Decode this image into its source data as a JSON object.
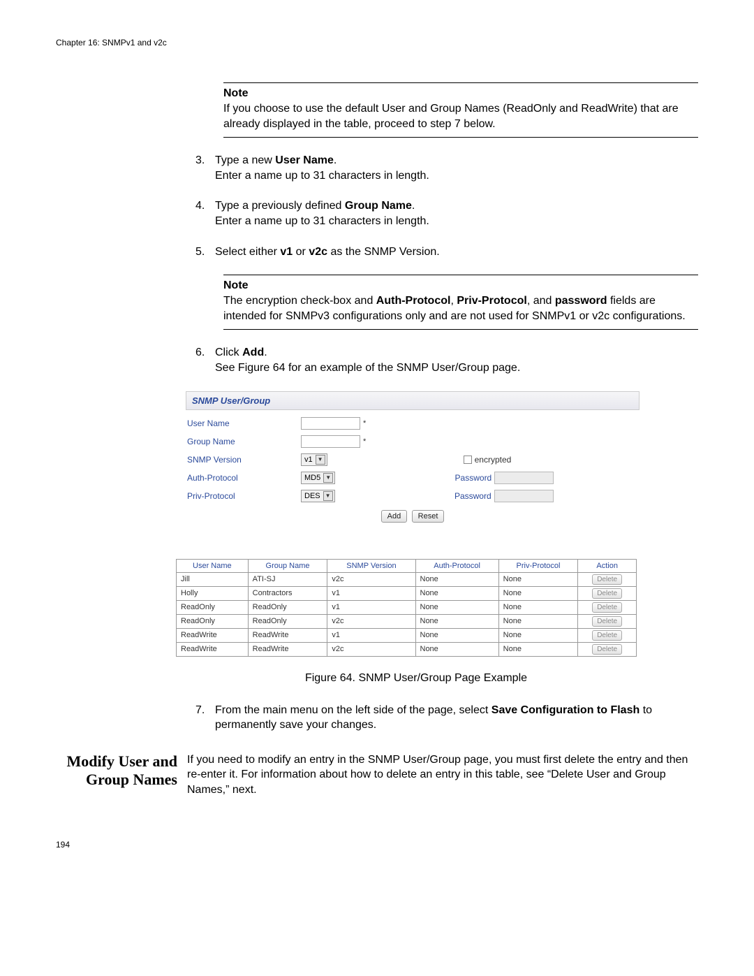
{
  "chapter_header": "Chapter 16: SNMPv1 and v2c",
  "note1": {
    "title": "Note",
    "body": "If you choose to use the default User and Group Names (ReadOnly and ReadWrite) that are already displayed in the table, proceed to step 7 below."
  },
  "steps": {
    "s3": {
      "num": "3.",
      "t1": "Type a new ",
      "b1": "User Name",
      "t2": ".",
      "line2": "Enter a name up to 31 characters in length."
    },
    "s4": {
      "num": "4.",
      "t1": "Type a previously defined ",
      "b1": "Group Name",
      "t2": ".",
      "line2": "Enter a name up to 31 characters in length."
    },
    "s5": {
      "num": "5.",
      "t1": "Select either ",
      "b1": "v1",
      "t2": " or ",
      "b2": "v2c",
      "t3": " as the SNMP Version."
    },
    "s6": {
      "num": "6.",
      "t1": "Click ",
      "b1": "Add",
      "t2": ".",
      "line2": "See Figure 64 for an example of the SNMP User/Group page."
    },
    "s7": {
      "num": "7.",
      "t1": "From the main menu on the left side of the page, select ",
      "b1": "Save Configuration to Flash",
      "t2": " to permanently save your changes."
    }
  },
  "note2": {
    "title": "Note",
    "t1": "The encryption check-box and ",
    "b1": "Auth-Protocol",
    "t2": ", ",
    "b2": "Priv-Protocol",
    "t3": ", and ",
    "b3": "password",
    "t4": " fields are intended for SNMPv3 configurations only and are not used for SNMPv1 or v2c configurations."
  },
  "panel": {
    "title": "SNMP User/Group",
    "labels": {
      "user": "User Name",
      "group": "Group Name",
      "version": "SNMP Version",
      "auth": "Auth-Protocol",
      "priv": "Priv-Protocol",
      "encrypted": "encrypted",
      "password": "Password"
    },
    "selects": {
      "version": "v1",
      "auth": "MD5",
      "priv": "DES"
    },
    "buttons": {
      "add": "Add",
      "reset": "Reset"
    },
    "asterisk": "*"
  },
  "table": {
    "headers": [
      "User Name",
      "Group Name",
      "SNMP Version",
      "Auth-Protocol",
      "Priv-Protocol",
      "Action"
    ],
    "delete": "Delete",
    "rows": [
      [
        "Jill",
        "ATI-SJ",
        "v2c",
        "None",
        "None"
      ],
      [
        "Holly",
        "Contractors",
        "v1",
        "None",
        "None"
      ],
      [
        "ReadOnly",
        "ReadOnly",
        "v1",
        "None",
        "None"
      ],
      [
        "ReadOnly",
        "ReadOnly",
        "v2c",
        "None",
        "None"
      ],
      [
        "ReadWrite",
        "ReadWrite",
        "v1",
        "None",
        "None"
      ],
      [
        "ReadWrite",
        "ReadWrite",
        "v2c",
        "None",
        "None"
      ]
    ]
  },
  "figure_caption": "Figure 64. SNMP User/Group Page Example",
  "section": {
    "heading": "Modify User and Group Names",
    "body": "If you need to modify an entry in the SNMP User/Group page, you must first delete the entry and then re-enter it. For information about how to delete an entry in this table, see “Delete User and Group Names,”  next."
  },
  "page_number": "194"
}
